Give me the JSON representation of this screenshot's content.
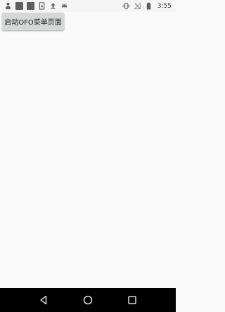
{
  "status_bar": {
    "time": "3:55",
    "left_icons": [
      "person-icon",
      "square-app-icon",
      "square-app-icon",
      "document-icon",
      "upload-icon",
      "android-icon"
    ],
    "right_icons": [
      "vibrate-icon",
      "no-signal-icon",
      "battery-icon"
    ]
  },
  "main": {
    "launch_button_label": "启动OFO菜单页面"
  },
  "nav_bar": {
    "buttons": [
      "back",
      "home",
      "recents"
    ]
  },
  "colors": {
    "background": "#fafafa",
    "button_bg": "#d6d7d7",
    "nav_bg": "#000000",
    "status_icon": "#5f5f5f"
  }
}
